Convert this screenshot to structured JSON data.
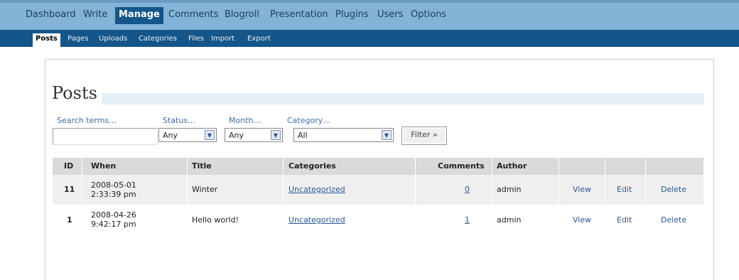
{
  "nav": {
    "items": [
      "Dashboard",
      "Write",
      "Manage",
      "Comments",
      "Blogroll",
      "Presentation",
      "Plugins",
      "Users",
      "Options"
    ],
    "active": "Manage"
  },
  "subnav": {
    "items": [
      "Posts",
      "Pages",
      "Uploads",
      "Categories",
      "Files",
      "Import",
      "Export"
    ],
    "active": "Posts"
  },
  "page": {
    "title": "Posts"
  },
  "filters": {
    "search_label": "Search terms…",
    "search_value": "",
    "status_label": "Status…",
    "status_value": "Any",
    "month_label": "Month…",
    "month_value": "Any",
    "category_label": "Category…",
    "category_value": "All",
    "filter_button": "Filter »"
  },
  "table": {
    "headers": [
      "ID",
      "When",
      "Title",
      "Categories",
      "Comments",
      "Author"
    ],
    "rows": [
      {
        "id": "11",
        "date": "2008-05-01",
        "time": "2:33:39 pm",
        "title": "Winter",
        "categories": "Uncategorized",
        "comments": "0",
        "author": "admin",
        "view": "View",
        "edit": "Edit",
        "delete": "Delete"
      },
      {
        "id": "1",
        "date": "2008-04-26",
        "time": "9:42:17 pm",
        "title": "Hello world!",
        "categories": "Uncategorized",
        "comments": "1",
        "author": "admin",
        "view": "View",
        "edit": "Edit",
        "delete": "Delete"
      }
    ]
  },
  "colors": {
    "top_nav": "#83b4d8",
    "sub_nav": "#14568a",
    "link": "#2a5a99",
    "label": "#3d6fa5"
  }
}
